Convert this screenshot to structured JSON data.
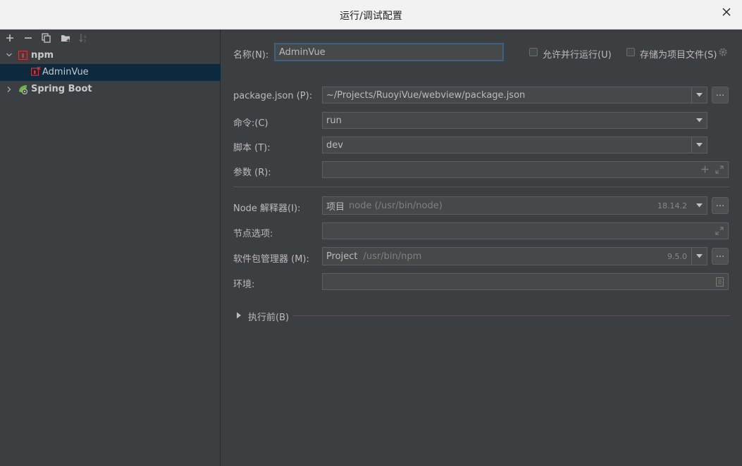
{
  "window": {
    "title": "运行/调试配置"
  },
  "tree": {
    "npm": "npm",
    "admin_vue": "AdminVue",
    "spring_boot": "Spring Boot"
  },
  "form": {
    "name_label": "名称(N):",
    "name_value": "AdminVue",
    "allow_parallel": "允许并行运行(U)",
    "store_as_file": "存储为项目文件(S)",
    "package_json_label": "package.json (P):",
    "package_json_value": "~/Projects/RuoyiVue/webview/package.json",
    "command_label": "命令:(C)",
    "command_value": "run",
    "scripts_label": "脚本 (T):",
    "scripts_value": "dev",
    "arguments_label": "参数 (R):",
    "arguments_value": "",
    "node_interpreter_label": "Node 解释器(I):",
    "node_interpreter_prefix": "项目",
    "node_interpreter_path": "node (/usr/bin/node)",
    "node_version": "18.14.2",
    "node_options_label": "节点选项:",
    "node_options_value": "",
    "package_manager_label": "软件包管理器 (M):",
    "package_manager_prefix": "Project",
    "package_manager_path": "/usr/bin/npm",
    "package_manager_version": "9.5.0",
    "env_label": "环境:",
    "env_value": "",
    "before_launch": "执行前(B)",
    "browse": "..."
  }
}
